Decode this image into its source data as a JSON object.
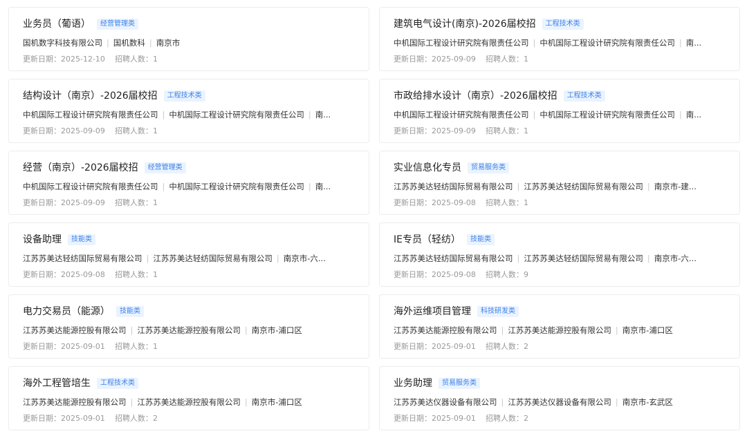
{
  "labels": {
    "update_date": "更新日期：",
    "headcount": "招聘人数："
  },
  "jobs": [
    {
      "title": "业务员（葡语）",
      "tag": "经营管理类",
      "company": "国机数字科技有限公司",
      "org": "国机数科",
      "location": "南京市",
      "date": "2025-12-10",
      "count": "1"
    },
    {
      "title": "建筑电气设计(南京)-2026届校招",
      "tag": "工程技术类",
      "company": "中机国际工程设计研究院有限责任公司",
      "org": "中机国际工程设计研究院有限责任公司",
      "location": "南...",
      "date": "2025-09-09",
      "count": "1"
    },
    {
      "title": "结构设计（南京）-2026届校招",
      "tag": "工程技术类",
      "company": "中机国际工程设计研究院有限责任公司",
      "org": "中机国际工程设计研究院有限责任公司",
      "location": "南...",
      "date": "2025-09-09",
      "count": "1"
    },
    {
      "title": "市政给排水设计（南京）-2026届校招",
      "tag": "工程技术类",
      "company": "中机国际工程设计研究院有限责任公司",
      "org": "中机国际工程设计研究院有限责任公司",
      "location": "南...",
      "date": "2025-09-09",
      "count": "1"
    },
    {
      "title": "经营（南京）-2026届校招",
      "tag": "经营管理类",
      "company": "中机国际工程设计研究院有限责任公司",
      "org": "中机国际工程设计研究院有限责任公司",
      "location": "南...",
      "date": "2025-09-09",
      "count": "1"
    },
    {
      "title": "实业信息化专员",
      "tag": "贸易服务类",
      "company": "江苏苏美达轻纺国际贸易有限公司",
      "org": "江苏苏美达轻纺国际贸易有限公司",
      "location": "南京市-建...",
      "date": "2025-09-08",
      "count": "1"
    },
    {
      "title": "设备助理",
      "tag": "技能类",
      "company": "江苏苏美达轻纺国际贸易有限公司",
      "org": "江苏苏美达轻纺国际贸易有限公司",
      "location": "南京市-六...",
      "date": "2025-09-08",
      "count": "1"
    },
    {
      "title": "IE专员（轻纺）",
      "tag": "技能类",
      "company": "江苏苏美达轻纺国际贸易有限公司",
      "org": "江苏苏美达轻纺国际贸易有限公司",
      "location": "南京市-六...",
      "date": "2025-09-08",
      "count": "9"
    },
    {
      "title": "电力交易员（能源）",
      "tag": "技能类",
      "company": "江苏苏美达能源控股有限公司",
      "org": "江苏苏美达能源控股有限公司",
      "location": "南京市-浦口区",
      "date": "2025-09-01",
      "count": "1"
    },
    {
      "title": "海外运维项目管理",
      "tag": "科技研发类",
      "company": "江苏苏美达能源控股有限公司",
      "org": "江苏苏美达能源控股有限公司",
      "location": "南京市-浦口区",
      "date": "2025-09-01",
      "count": "2"
    },
    {
      "title": "海外工程管培生",
      "tag": "工程技术类",
      "company": "江苏苏美达能源控股有限公司",
      "org": "江苏苏美达能源控股有限公司",
      "location": "南京市-浦口区",
      "date": "2025-09-01",
      "count": "2"
    },
    {
      "title": "业务助理",
      "tag": "贸易服务类",
      "company": "江苏苏美达仪器设备有限公司",
      "org": "江苏苏美达仪器设备有限公司",
      "location": "南京市-玄武区",
      "date": "2025-09-01",
      "count": "2"
    }
  ]
}
